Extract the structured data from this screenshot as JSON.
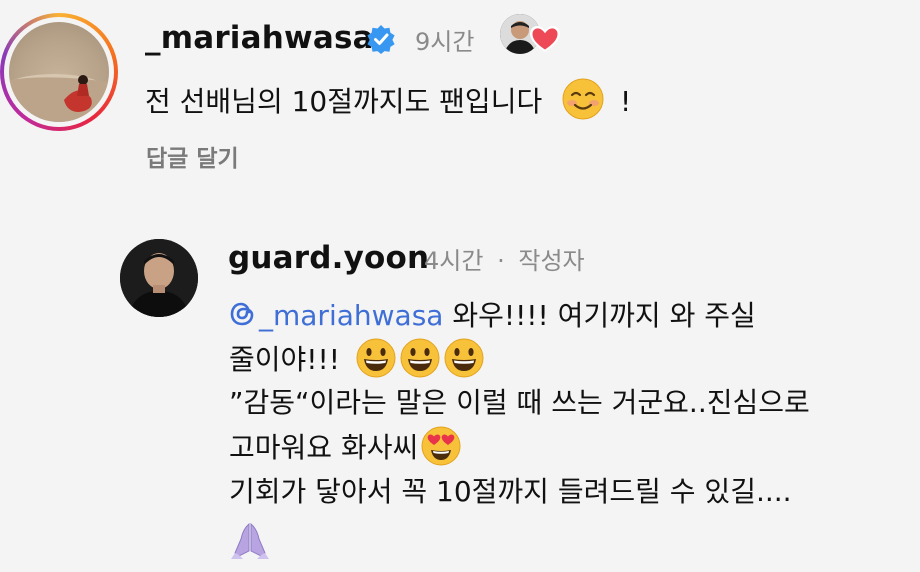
{
  "comment1": {
    "username": "_mariahwasa",
    "time": "9시간",
    "text": "전 선배님의 10절까지도 팬입니다",
    "text_suffix": "!",
    "reply_label": "답글 달기"
  },
  "comment2": {
    "username": "guard.yoon",
    "time": "4시간",
    "dot": "·",
    "author_tag": "작성자",
    "mention": "_mariahwasa",
    "line1_rest": " 와우!!!! 여기까지 와 주실",
    "line2": "줄이야!!!",
    "line3": "”감동“이라는 말은 이럴 때 쓰는 거군요..진심으로",
    "line4": "고마워요 화사씨",
    "line5": "기회가 닿아서 꼭 10절까지 들려드릴 수 있길...."
  },
  "icons": {
    "verified": "verified-badge-icon",
    "heart": "liked-by-author-heart-icon",
    "threads": "threads-icon",
    "smiling_blush": "smiling-face-emoji",
    "grin": "grinning-face-emoji",
    "heart_eyes": "heart-eyes-emoji",
    "folded_hands": "folded-hands-emoji"
  },
  "colors": {
    "mention": "#3f6fd6",
    "verified": "#3897f0",
    "heart": "#ed4956",
    "muted": "#8a8a8a"
  }
}
